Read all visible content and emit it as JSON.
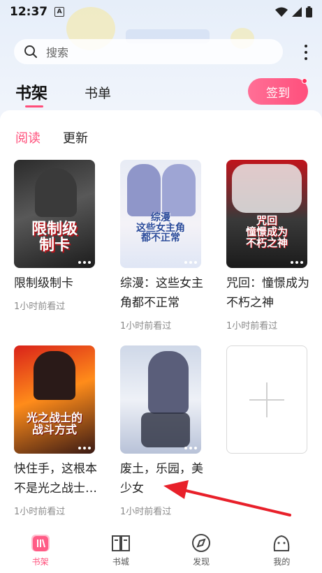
{
  "status_bar": {
    "time": "12:37",
    "indicator": "A"
  },
  "search": {
    "placeholder": "搜索"
  },
  "tabs": {
    "shelf": "书架",
    "list": "书单"
  },
  "checkin": {
    "label": "签到"
  },
  "subtabs": {
    "read": "阅读",
    "update": "更新"
  },
  "books": [
    {
      "title": "限制级制卡",
      "time": "1小时前看过",
      "cover_text": "限制级\n制卡"
    },
    {
      "title": "综漫：这些女主角都不正常",
      "time": "1小时前看过",
      "cover_text": "综漫\n这些女主角\n都不正常"
    },
    {
      "title": "咒回：憧憬成为不朽之神",
      "time": "1小时前看过",
      "cover_text": "咒回\n憧憬成为\n不朽之神"
    },
    {
      "title": "快住手，这根本不是光之战士的战斗方式",
      "time": "1小时前看过",
      "cover_text": "光之战士的\n战斗方式"
    },
    {
      "title": "废土，乐园，美少女",
      "time": "1小时前看过",
      "cover_text": ""
    }
  ],
  "nav": [
    {
      "label": "书架",
      "icon": "bookshelf-icon"
    },
    {
      "label": "书城",
      "icon": "bookstore-icon"
    },
    {
      "label": "发现",
      "icon": "compass-icon"
    },
    {
      "label": "我的",
      "icon": "profile-icon"
    }
  ],
  "colors": {
    "accent": "#ff4e7a",
    "annotation_arrow": "#e8202a"
  }
}
